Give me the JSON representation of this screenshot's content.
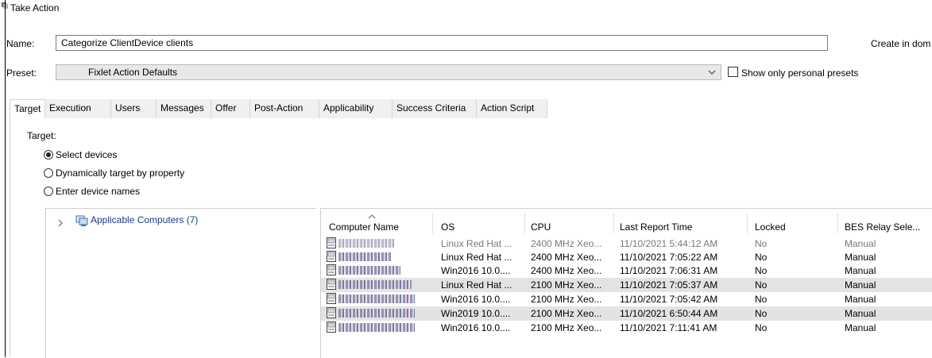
{
  "window": {
    "title": "Take Action"
  },
  "form": {
    "name_label": "Name:",
    "name_value": "Categorize ClientDevice clients",
    "create_label": "Create in dom",
    "preset_label": "Preset:",
    "preset_value": "Fixlet Action Defaults",
    "show_personal_label": "Show only personal presets"
  },
  "tabs": [
    {
      "label": "Target",
      "active": true
    },
    {
      "label": "Execution"
    },
    {
      "label": "Users"
    },
    {
      "label": "Messages"
    },
    {
      "label": "Offer"
    },
    {
      "label": "Post-Action"
    },
    {
      "label": "Applicability"
    },
    {
      "label": "Success Criteria"
    },
    {
      "label": "Action Script"
    }
  ],
  "target": {
    "heading": "Target:",
    "options": [
      {
        "label": "Select devices",
        "selected": true
      },
      {
        "label": "Dynamically target by property",
        "selected": false
      },
      {
        "label": "Enter device names",
        "selected": false
      }
    ]
  },
  "tree": {
    "label": "Applicable Computers (7)"
  },
  "grid": {
    "columns": [
      "Computer Name",
      "OS",
      "CPU",
      "Last Report Time",
      "Locked",
      "BES Relay Sele..."
    ],
    "rows": [
      {
        "os": "Linux Red Hat ...",
        "cpu": "2400 MHz Xeo...",
        "time": "11/10/2021 5:44:12 AM",
        "locked": "No",
        "relay": "Manual",
        "dim": true,
        "selected": false
      },
      {
        "os": "Linux Red Hat ...",
        "cpu": "2400 MHz Xeo...",
        "time": "11/10/2021 7:05:22 AM",
        "locked": "No",
        "relay": "Manual",
        "dim": false,
        "selected": false
      },
      {
        "os": "Win2016 10.0....",
        "cpu": "2400 MHz Xeo...",
        "time": "11/10/2021 7:06:31 AM",
        "locked": "No",
        "relay": "Manual",
        "dim": false,
        "selected": false
      },
      {
        "os": "Linux Red Hat ...",
        "cpu": "2100 MHz Xeo...",
        "time": "11/10/2021 7:05:37 AM",
        "locked": "No",
        "relay": "Manual",
        "dim": false,
        "selected": true
      },
      {
        "os": "Win2016 10.0....",
        "cpu": "2100 MHz Xeo...",
        "time": "11/10/2021 7:05:42 AM",
        "locked": "No",
        "relay": "Manual",
        "dim": false,
        "selected": false
      },
      {
        "os": "Win2019 10.0....",
        "cpu": "2100 MHz Xeo...",
        "time": "11/10/2021 6:50:44 AM",
        "locked": "No",
        "relay": "Manual",
        "dim": false,
        "selected": true
      },
      {
        "os": "Win2016 10.0....",
        "cpu": "2100 MHz Xeo...",
        "time": "11/10/2021 7:11:41 AM",
        "locked": "No",
        "relay": "Manual",
        "dim": false,
        "selected": false
      }
    ]
  }
}
